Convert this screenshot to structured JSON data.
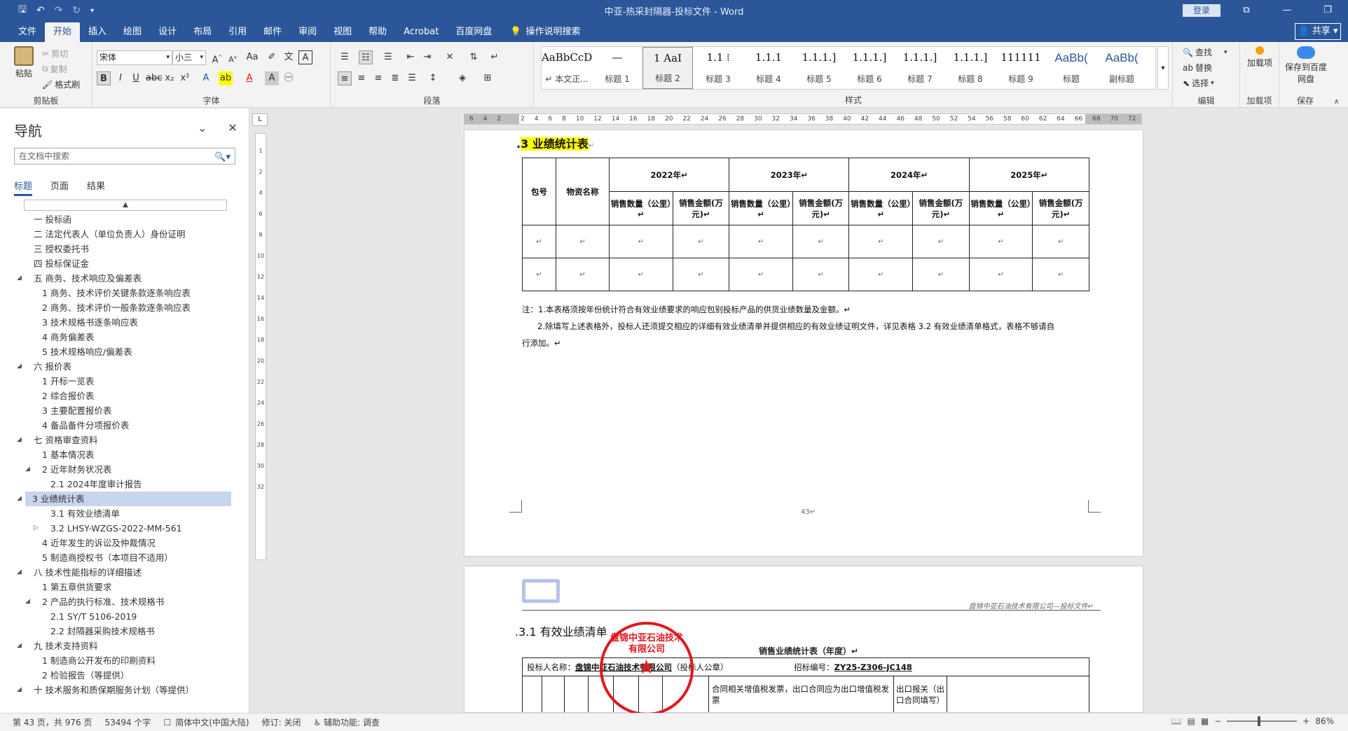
{
  "titlebar": {
    "title": "中亚-热采封隔器-投标文件 - Word",
    "login": "登录",
    "qat_icons": [
      "save-icon",
      "undo-icon",
      "redo-icon",
      "autosave-icon",
      "customize-qat-icon"
    ]
  },
  "tabs": [
    "文件",
    "开始",
    "插入",
    "绘图",
    "设计",
    "布局",
    "引用",
    "邮件",
    "审阅",
    "视图",
    "帮助",
    "Acrobat",
    "百度网盘"
  ],
  "active_tab": "开始",
  "tell_me": "操作说明搜索",
  "share": "共享",
  "ribbon": {
    "clipboard": {
      "paste": "粘贴",
      "cut": "剪切",
      "copy": "复制",
      "format_painter": "格式刷",
      "label": "剪贴板"
    },
    "font": {
      "name": "宋体",
      "size": "小三",
      "label": "字体"
    },
    "paragraph": {
      "label": "段落"
    },
    "styles": {
      "label": "样式",
      "items": [
        {
          "preview": "AaBbCcDdI",
          "name": "↵ 本文正..."
        },
        {
          "preview": "—",
          "name": "标题 1"
        },
        {
          "preview": "1 AaI",
          "name": "标题 2"
        },
        {
          "preview": "1.1 ⁞",
          "name": "标题 3"
        },
        {
          "preview": "1.1.1",
          "name": "标题 4"
        },
        {
          "preview": "1.1.1.]",
          "name": "标题 5"
        },
        {
          "preview": "1.1.1.]",
          "name": "标题 6"
        },
        {
          "preview": "1.1.1.]",
          "name": "标题 7"
        },
        {
          "preview": "1.1.1.]",
          "name": "标题 8"
        },
        {
          "preview": "111111",
          "name": "标题 9"
        },
        {
          "preview": "AaBb(",
          "name": "标题"
        },
        {
          "preview": "AaBb(",
          "name": "副标题"
        }
      ]
    },
    "editing": {
      "find": "查找",
      "replace": "替换",
      "select": "选择",
      "label": "编辑"
    },
    "addins": {
      "load": "加载项",
      "label": "加载项"
    },
    "save": {
      "save_baidu": "保存到百度网盘",
      "label": "保存"
    }
  },
  "nav": {
    "title": "导航",
    "search_placeholder": "在文档中搜索",
    "tabs": [
      "标题",
      "页面",
      "结果"
    ],
    "items": [
      {
        "text": "一 投标函",
        "level": 0,
        "arrow": ""
      },
      {
        "text": "二 法定代表人（单位负责人）身份证明",
        "level": 0,
        "arrow": ""
      },
      {
        "text": "三 授权委托书",
        "level": 0,
        "arrow": ""
      },
      {
        "text": "四 投标保证金",
        "level": 0,
        "arrow": ""
      },
      {
        "text": "五 商务、技术响应及偏差表",
        "level": 0,
        "arrow": "◢"
      },
      {
        "text": "1 商务、技术评价关键条款逐条响应表",
        "level": 1,
        "arrow": ""
      },
      {
        "text": "2 商务、技术评价一般条款逐条响应表",
        "level": 1,
        "arrow": ""
      },
      {
        "text": "3 技术规格书逐条响应表",
        "level": 1,
        "arrow": ""
      },
      {
        "text": "4 商务偏差表",
        "level": 1,
        "arrow": ""
      },
      {
        "text": "5 技术规格响应/偏差表",
        "level": 1,
        "arrow": ""
      },
      {
        "text": "六 报价表",
        "level": 0,
        "arrow": "◢"
      },
      {
        "text": "1 开标一览表",
        "level": 1,
        "arrow": ""
      },
      {
        "text": "2 综合报价表",
        "level": 1,
        "arrow": ""
      },
      {
        "text": "3 主要配置报价表",
        "level": 1,
        "arrow": ""
      },
      {
        "text": "4 备品备件分项报价表",
        "level": 1,
        "arrow": ""
      },
      {
        "text": "七 资格审查资料",
        "level": 0,
        "arrow": "◢"
      },
      {
        "text": "1 基本情况表",
        "level": 1,
        "arrow": ""
      },
      {
        "text": "2 近年财务状况表",
        "level": 1,
        "arrow": "◢"
      },
      {
        "text": "2.1 2024年度审计报告",
        "level": 2,
        "arrow": ""
      },
      {
        "text": "3 业绩统计表",
        "level": 1,
        "arrow": "◢",
        "selected": true
      },
      {
        "text": "3.1 有效业绩清单",
        "level": 2,
        "arrow": ""
      },
      {
        "text": "3.2 LHSY-WZGS-2022-MM-561",
        "level": 2,
        "arrow": "▷"
      },
      {
        "text": "4 近年发生的诉讼及仲裁情况",
        "level": 1,
        "arrow": ""
      },
      {
        "text": "5 制造商授权书（本项目不适用）",
        "level": 1,
        "arrow": ""
      },
      {
        "text": "八 技术性能指标的详细描述",
        "level": 0,
        "arrow": "◢"
      },
      {
        "text": "1 第五章供货要求",
        "level": 1,
        "arrow": ""
      },
      {
        "text": "2 产品的执行标准、技术规格书",
        "level": 1,
        "arrow": "◢"
      },
      {
        "text": "2.1 SY/T 5106-2019",
        "level": 2,
        "arrow": ""
      },
      {
        "text": "2.2 封隔器采购技术规格书",
        "level": 2,
        "arrow": ""
      },
      {
        "text": "九 技术支持资料",
        "level": 0,
        "arrow": "◢"
      },
      {
        "text": "1 制造商公开发布的印刷资料",
        "level": 1,
        "arrow": ""
      },
      {
        "text": "2 检验报告（等提供）",
        "level": 1,
        "arrow": ""
      },
      {
        "text": "十 技术服务和质保期服务计划（等提供）",
        "level": 0,
        "arrow": "◢"
      }
    ]
  },
  "ruler": {
    "h_numbers": [
      "6",
      "4",
      "2",
      "",
      "2",
      "4",
      "6",
      "8",
      "10",
      "12",
      "14",
      "16",
      "18",
      "20",
      "22",
      "24",
      "26",
      "28",
      "30",
      "32",
      "34",
      "36",
      "38",
      "40",
      "42",
      "44",
      "46",
      "48",
      "50",
      "52",
      "54",
      "56",
      "58",
      "60",
      "62",
      "64",
      "66",
      "68",
      "70",
      "72"
    ],
    "v_numbers": [
      "1",
      "2",
      "4",
      "6",
      "8",
      "10",
      "12",
      "14",
      "16",
      "18",
      "20",
      "22",
      "24",
      "26",
      "28",
      "30",
      "32"
    ]
  },
  "page1": {
    "heading_prefix": ".",
    "heading": "3 业绩统计表",
    "table": {
      "h_pkg": "包号",
      "h_material": "物资名称",
      "years": [
        "2022年↵",
        "2023年↵",
        "2024年↵",
        "2025年↵"
      ],
      "sub": [
        "销售数量（公里）↵",
        "销售金额(万元)↵",
        "销售数量（公里）↵",
        "销售金额(万元)↵",
        "销售数量（公里）↵",
        "销售金额(万元)↵",
        "销售数量（公里）↵",
        "销售金额(万元)↵"
      ],
      "empty": "↵"
    },
    "note1": "注：1.本表格须按年份统计符合有效业绩要求的响应包别投标产品的供货业绩数量及金额。↵",
    "note2": "2.除填写上述表格外，投标人还须提交相应的详细有效业绩清单并提供相应的有效业绩证明文件，详见表格 3.2 有效业绩清单格式，表格不够请自",
    "note3": "行添加。↵",
    "page_number": "43↵"
  },
  "page2": {
    "company": "盘锦中亚石油技术有限公司—投标文件↵",
    "heading": ".3.1 有效业绩清单",
    "table_title": "销售业绩统计表（年度）↵",
    "bidder_label": "投标人名称：",
    "bidder": "盘锦中亚石油技术有限公司",
    "stamp_note": "（投标人公章）",
    "bid_no_label": "招标编号：",
    "bid_no": "ZY25-Z306-JC148",
    "col_vat": "合同相关增值税发票，出口合同应为出口增值税发票",
    "col_export": "出口报关（出口合同填写）",
    "stamp_text": "盘锦中亚石油技术有限公司"
  },
  "status": {
    "page": "第 43 页，共 976 页",
    "words": "53494 个字",
    "language": "简体中文(中国大陆)",
    "track": "修订: 关闭",
    "accessibility": "辅助功能: 调查",
    "zoom": "86%"
  }
}
